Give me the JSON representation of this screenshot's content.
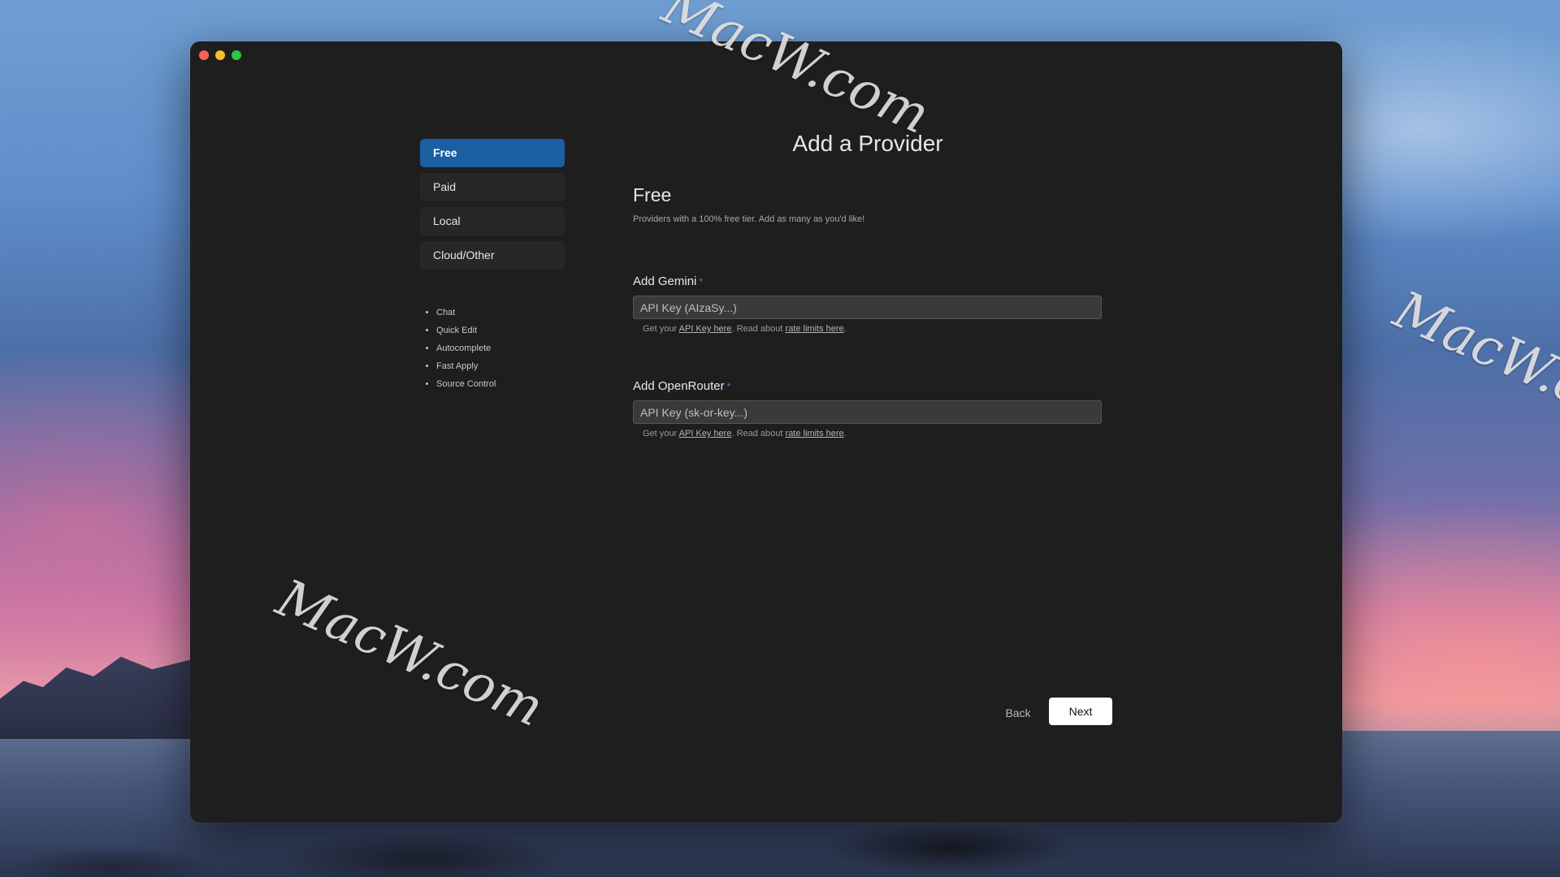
{
  "window": {
    "controls": [
      "close",
      "minimize",
      "maximize"
    ]
  },
  "sidebar": {
    "tabs": [
      {
        "label": "Free",
        "active": true
      },
      {
        "label": "Paid",
        "active": false
      },
      {
        "label": "Local",
        "active": false
      },
      {
        "label": "Cloud/Other",
        "active": false
      }
    ],
    "features": [
      "Chat",
      "Quick Edit",
      "Autocomplete",
      "Fast Apply",
      "Source Control"
    ]
  },
  "main": {
    "title": "Add a Provider",
    "section_title": "Free",
    "section_desc": "Providers with a 100% free tier. Add as many as you'd like!",
    "providers": [
      {
        "label": "Add Gemini",
        "required_mark": "*",
        "placeholder": "API Key (AIzaSy...)",
        "value": "",
        "hint_prefix": "Get your ",
        "hint_link1": "API Key here",
        "hint_mid": ". Read about ",
        "hint_link2": "rate limits here",
        "hint_suffix": "."
      },
      {
        "label": "Add OpenRouter",
        "required_mark": "*",
        "placeholder": "API Key (sk-or-key...)",
        "value": "",
        "hint_prefix": "Get your ",
        "hint_link1": "API Key here",
        "hint_mid": ". Read about ",
        "hint_link2": "rate limits here",
        "hint_suffix": "."
      }
    ]
  },
  "footer": {
    "back_label": "Back",
    "next_label": "Next"
  },
  "watermark": {
    "text": "MacW.com"
  },
  "colors": {
    "window_bg": "#1e1e1e",
    "active_tab": "#1c5fa1",
    "required_mark": "#3b82d6",
    "next_button": "#ffffff"
  }
}
